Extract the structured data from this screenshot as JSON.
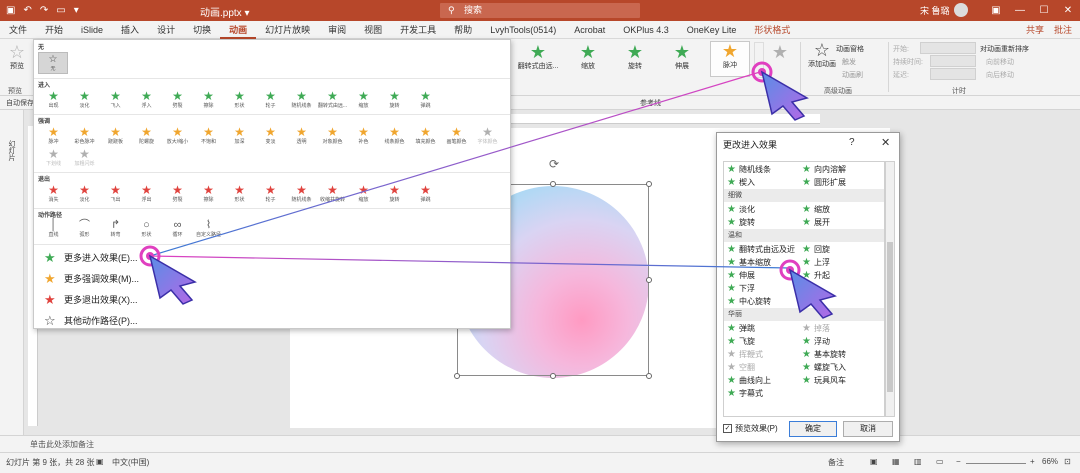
{
  "titlebar": {
    "file_menu": "文件",
    "doc_title": "动画.pptx  ▾",
    "search_placeholder": "搜索",
    "user_name": "宋 鲁璐"
  },
  "tabs": [
    "文件",
    "开始",
    "iSlide",
    "插入",
    "设计",
    "切换",
    "动画",
    "幻灯片放映",
    "审阅",
    "视图",
    "开发工具",
    "帮助",
    "LvyhTools(0514)",
    "Acrobat",
    "OKPlus 4.3",
    "OneKey Lite",
    "形状格式"
  ],
  "active_tab": "动画",
  "tabs_right": {
    "share": "共享",
    "comment": "批注"
  },
  "ribbon": {
    "preview": "预览",
    "preview_group": "预览",
    "autosave": "自动保存",
    "effects": [
      "翻转式由远...",
      "缩放",
      "旋转",
      "伸展",
      "脉冲"
    ],
    "add_animation": "添加动画",
    "animation_pane": "动画窗格",
    "trigger": "触发",
    "painter": "动画刷",
    "advanced_group": "高级动画",
    "start": "开始:",
    "duration": "持续时间:",
    "delay": "延迟:",
    "reorder": "对动画重新排序",
    "move_earlier": "向前移动",
    "move_later": "向后移动",
    "timing_group": "计时",
    "reference_line": "参考线"
  },
  "gallery": {
    "none_section": "无",
    "none_item": "无",
    "entrance_section": "进入",
    "entrance_items": [
      "出现",
      "淡化",
      "飞入",
      "浮入",
      "劈裂",
      "擦除",
      "形状",
      "轮子",
      "随机线条",
      "翻转式由远...",
      "缩放",
      "旋转",
      "弹跳"
    ],
    "emphasis_section": "强调",
    "emphasis_items": [
      "脉冲",
      "彩色脉冲",
      "跷跷板",
      "陀螺旋",
      "放大/缩小",
      "不饱和",
      "加深",
      "变淡",
      "透明",
      "对象颜色",
      "补色",
      "线条颜色",
      "填充颜色",
      "画笔颜色",
      "字体颜色",
      "下划线",
      "加粗闪烁"
    ],
    "exit_section": "退出",
    "exit_items": [
      "消失",
      "淡化",
      "飞出",
      "浮出",
      "劈裂",
      "擦除",
      "形状",
      "轮子",
      "随机线条",
      "收缩并旋转",
      "缩放",
      "旋转",
      "弹跳"
    ],
    "path_section": "动作路径",
    "path_items": [
      "直线",
      "弧形",
      "转弯",
      "形状",
      "循环",
      "自定义路径"
    ],
    "more_entrance": "更多进入效果(E)...",
    "more_emphasis": "更多强调效果(M)...",
    "more_exit": "更多退出效果(X)...",
    "more_path": "其他动作路径(P)..."
  },
  "dialog": {
    "title": "更改进入效果",
    "help": "?",
    "close": "✕",
    "basic_items": [
      [
        "随机线条",
        "向内溶解"
      ],
      [
        "楔入",
        "圆形扩展"
      ]
    ],
    "subtle_cat": "细微",
    "subtle_items": [
      [
        "淡化",
        "缩放"
      ],
      [
        "旋转",
        "展开"
      ]
    ],
    "moderate_cat": "温和",
    "moderate_items": [
      [
        "翻转式由远及近",
        "回旋"
      ],
      [
        "基本缩放",
        "上浮"
      ],
      [
        "伸展",
        "升起"
      ],
      [
        "下浮",
        ""
      ],
      [
        "中心旋转",
        ""
      ]
    ],
    "exciting_cat": "华丽",
    "exciting_items": [
      [
        "弹跳",
        "掉落"
      ],
      [
        "飞旋",
        "浮动"
      ],
      [
        "挥鞭式",
        "基本旋转"
      ],
      [
        "空翻",
        "螺旋飞入"
      ],
      [
        "曲线向上",
        "玩具风车"
      ],
      [
        "字幕式",
        ""
      ]
    ],
    "preview_label": "预览效果(P)",
    "ok": "确定",
    "cancel": "取消"
  },
  "notes_placeholder": "单击此处添加备注",
  "status": {
    "slide": "幻灯片 第 9 张，共 28 张",
    "language": "中文(中国)",
    "notes": "备注",
    "zoom": "66%"
  },
  "colors": {
    "accent": "#b7472a",
    "entrance": "#3faa55",
    "emphasis": "#f0a62f",
    "exit": "#e0433e",
    "cursor": "#7a5ce0",
    "click_ring": "#e040c0"
  }
}
